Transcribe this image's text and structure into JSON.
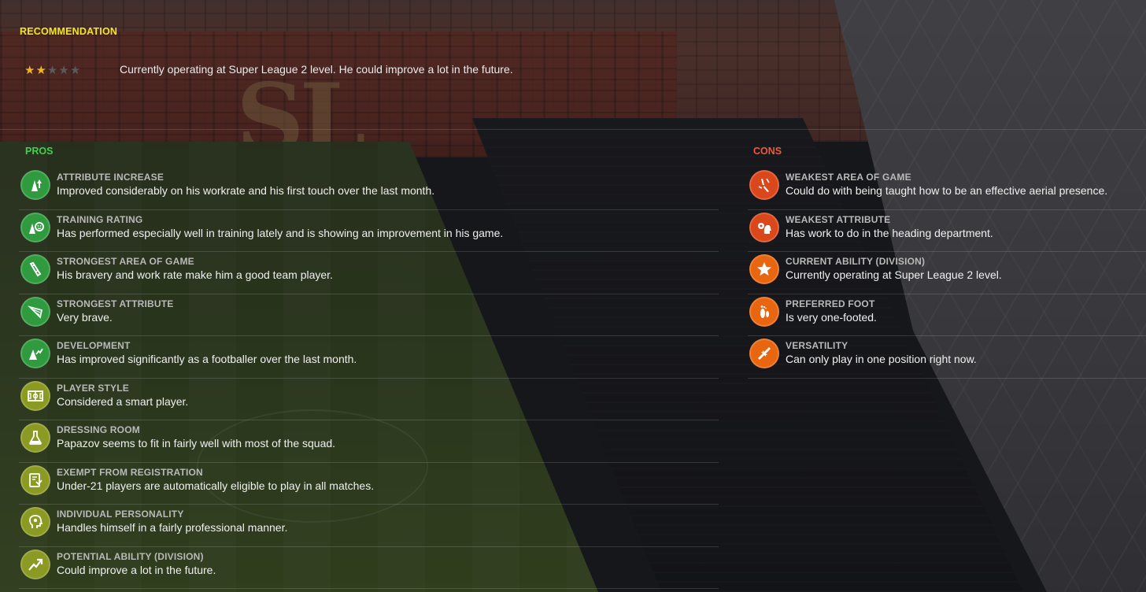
{
  "recommendation": {
    "heading": "RECOMMENDATION",
    "stars_filled": 2,
    "stars_total": 5,
    "text": "Currently operating at Super League 2 level. He could improve a lot in the future."
  },
  "pros": {
    "heading": "PROS",
    "items": [
      {
        "label": "ATTRIBUTE INCREASE",
        "desc": "Improved considerably on his workrate and his first touch over the last month.",
        "icon": "attribute-increase-icon",
        "color": "#2f9a3e"
      },
      {
        "label": "TRAINING RATING",
        "desc": "Has performed especially well in training lately and is showing an improvement in his game.",
        "icon": "training-rating-icon",
        "color": "#2f9a3e"
      },
      {
        "label": "STRONGEST AREA OF GAME",
        "desc": "His bravery and work rate make him a good team player.",
        "icon": "strongest-area-icon",
        "color": "#2f9a3e"
      },
      {
        "label": "STRONGEST ATTRIBUTE",
        "desc": "Very brave.",
        "icon": "strongest-attribute-icon",
        "color": "#2f9a3e"
      },
      {
        "label": "DEVELOPMENT",
        "desc": "Has improved significantly as a footballer over the last month.",
        "icon": "development-icon",
        "color": "#2f9a3e"
      },
      {
        "label": "PLAYER STYLE",
        "desc": "Considered a smart player.",
        "icon": "pitch-icon",
        "color": "#8a9a22"
      },
      {
        "label": "DRESSING ROOM",
        "desc": "Papazov seems to fit in fairly well with most of the squad.",
        "icon": "flask-icon",
        "color": "#8a9a22"
      },
      {
        "label": "EXEMPT FROM REGISTRATION",
        "desc": "Under-21 players are automatically eligible to play in all matches.",
        "icon": "registration-icon",
        "color": "#8a9a22"
      },
      {
        "label": "INDIVIDUAL PERSONALITY",
        "desc": "Handles himself in a fairly professional manner.",
        "icon": "head-icon",
        "color": "#8a9a22"
      },
      {
        "label": "POTENTIAL ABILITY (DIVISION)",
        "desc": "Could improve a lot in the future.",
        "icon": "trend-up-icon",
        "color": "#8a9a22"
      }
    ]
  },
  "cons": {
    "heading": "CONS",
    "items": [
      {
        "label": "WEAKEST AREA OF GAME",
        "desc": "Could do with being taught how to be an effective aerial presence.",
        "icon": "weakest-area-icon",
        "color": "#d9471b"
      },
      {
        "label": "WEAKEST ATTRIBUTE",
        "desc": "Has work to do in the heading department.",
        "icon": "heading-ball-icon",
        "color": "#d9471b"
      },
      {
        "label": "CURRENT ABILITY (DIVISION)",
        "desc": "Currently operating at Super League 2 level.",
        "icon": "star-icon",
        "color": "#e8660f"
      },
      {
        "label": "PREFERRED FOOT",
        "desc": "Is very one-footed.",
        "icon": "footprint-icon",
        "color": "#e8660f"
      },
      {
        "label": "VERSATILITY",
        "desc": "Can only play in one position right now.",
        "icon": "swap-arrows-icon",
        "color": "#e8660f"
      }
    ]
  }
}
